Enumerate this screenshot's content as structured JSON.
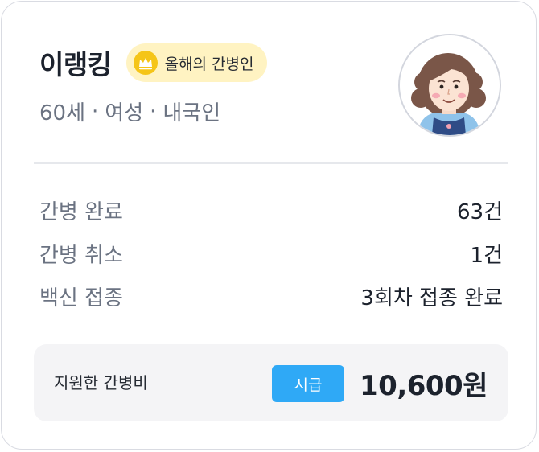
{
  "profile": {
    "name": "이랭킹",
    "badge": {
      "label": "올해의 간병인",
      "icon": "crown-icon",
      "background": "#fff3c2",
      "icon_color": "#f5c518"
    },
    "age": "60세",
    "gender": "여성",
    "nationality": "내국인",
    "separator": "·",
    "avatar": "avatar-illustration"
  },
  "stats": [
    {
      "label": "간병 완료",
      "value": "63건"
    },
    {
      "label": "간병 취소",
      "value": "1건"
    },
    {
      "label": "백신 접종",
      "value": "3회차 접종 완료"
    }
  ],
  "fee": {
    "label": "지원한 간병비",
    "rate_type": "시급",
    "amount": "10,600원",
    "rate_badge_color": "#2fa9f6"
  }
}
